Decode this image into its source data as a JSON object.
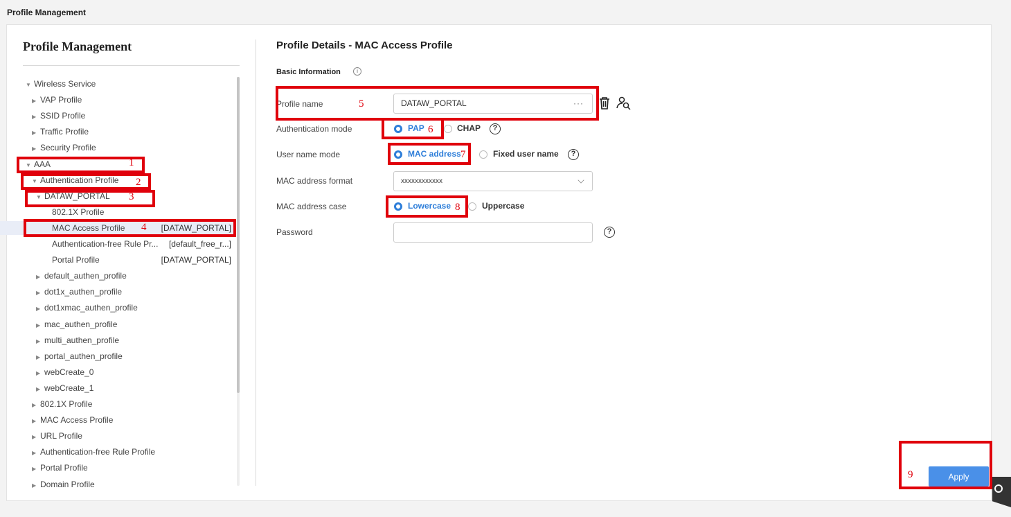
{
  "page_title": "Profile Management",
  "left_panel": {
    "title": "Profile Management",
    "tree": [
      {
        "arrow": "▼",
        "label": "Wireless Service",
        "tag": ""
      },
      {
        "arrow": "▶",
        "label": "VAP Profile",
        "tag": ""
      },
      {
        "arrow": "▶",
        "label": "SSID Profile",
        "tag": ""
      },
      {
        "arrow": "▶",
        "label": "Traffic Profile",
        "tag": ""
      },
      {
        "arrow": "▶",
        "label": "Security Profile",
        "tag": ""
      },
      {
        "arrow": "▼",
        "label": "AAA",
        "tag": ""
      },
      {
        "arrow": "▼",
        "label": "Authentication Profile",
        "tag": ""
      },
      {
        "arrow": "▼",
        "label": "DATAW_PORTAL",
        "tag": ""
      },
      {
        "arrow": "",
        "label": "802.1X Profile",
        "tag": ""
      },
      {
        "arrow": "",
        "label": "MAC Access Profile",
        "tag": "[DATAW_PORTAL]"
      },
      {
        "arrow": "",
        "label": "Authentication-free Rule Pr...",
        "tag": "[default_free_r...]"
      },
      {
        "arrow": "",
        "label": "Portal Profile",
        "tag": "[DATAW_PORTAL]"
      },
      {
        "arrow": "▶",
        "label": "default_authen_profile",
        "tag": ""
      },
      {
        "arrow": "▶",
        "label": "dot1x_authen_profile",
        "tag": ""
      },
      {
        "arrow": "▶",
        "label": "dot1xmac_authen_profile",
        "tag": ""
      },
      {
        "arrow": "▶",
        "label": "mac_authen_profile",
        "tag": ""
      },
      {
        "arrow": "▶",
        "label": "multi_authen_profile",
        "tag": ""
      },
      {
        "arrow": "▶",
        "label": "portal_authen_profile",
        "tag": ""
      },
      {
        "arrow": "▶",
        "label": "webCreate_0",
        "tag": ""
      },
      {
        "arrow": "▶",
        "label": "webCreate_1",
        "tag": ""
      },
      {
        "arrow": "▶",
        "label": "802.1X Profile",
        "tag": ""
      },
      {
        "arrow": "▶",
        "label": "MAC Access Profile",
        "tag": ""
      },
      {
        "arrow": "▶",
        "label": "URL Profile",
        "tag": ""
      },
      {
        "arrow": "▶",
        "label": "Authentication-free Rule Profile",
        "tag": ""
      },
      {
        "arrow": "▶",
        "label": "Portal Profile",
        "tag": ""
      },
      {
        "arrow": "▶",
        "label": "Domain Profile",
        "tag": ""
      }
    ]
  },
  "details": {
    "title": "Profile Details - MAC Access Profile",
    "section": "Basic Information",
    "info_glyph": "i",
    "profile_name": {
      "label": "Profile name",
      "value": "DATAW_PORTAL",
      "dots": "···"
    },
    "auth_mode": {
      "label": "Authentication mode",
      "options": [
        "PAP",
        "CHAP"
      ],
      "selected": "PAP"
    },
    "user_name_mode": {
      "label": "User name mode",
      "options": [
        "MAC address",
        "Fixed user name"
      ],
      "selected": "MAC address"
    },
    "mac_format": {
      "label": "MAC address format",
      "value": "xxxxxxxxxxxx"
    },
    "mac_case": {
      "label": "MAC address case",
      "options": [
        "Lowercase",
        "Uppercase"
      ],
      "selected": "Lowercase"
    },
    "password": {
      "label": "Password",
      "value": ""
    },
    "help_glyph": "?",
    "apply_label": "Apply"
  },
  "annotations": [
    "1",
    "2",
    "3",
    "4",
    "5",
    "6",
    "7",
    "8",
    "9"
  ],
  "colors": {
    "accent": "#2e7ed9",
    "apply": "#4a90e8",
    "annotation": "#e0000b",
    "selected_row": "#e9edf7"
  }
}
